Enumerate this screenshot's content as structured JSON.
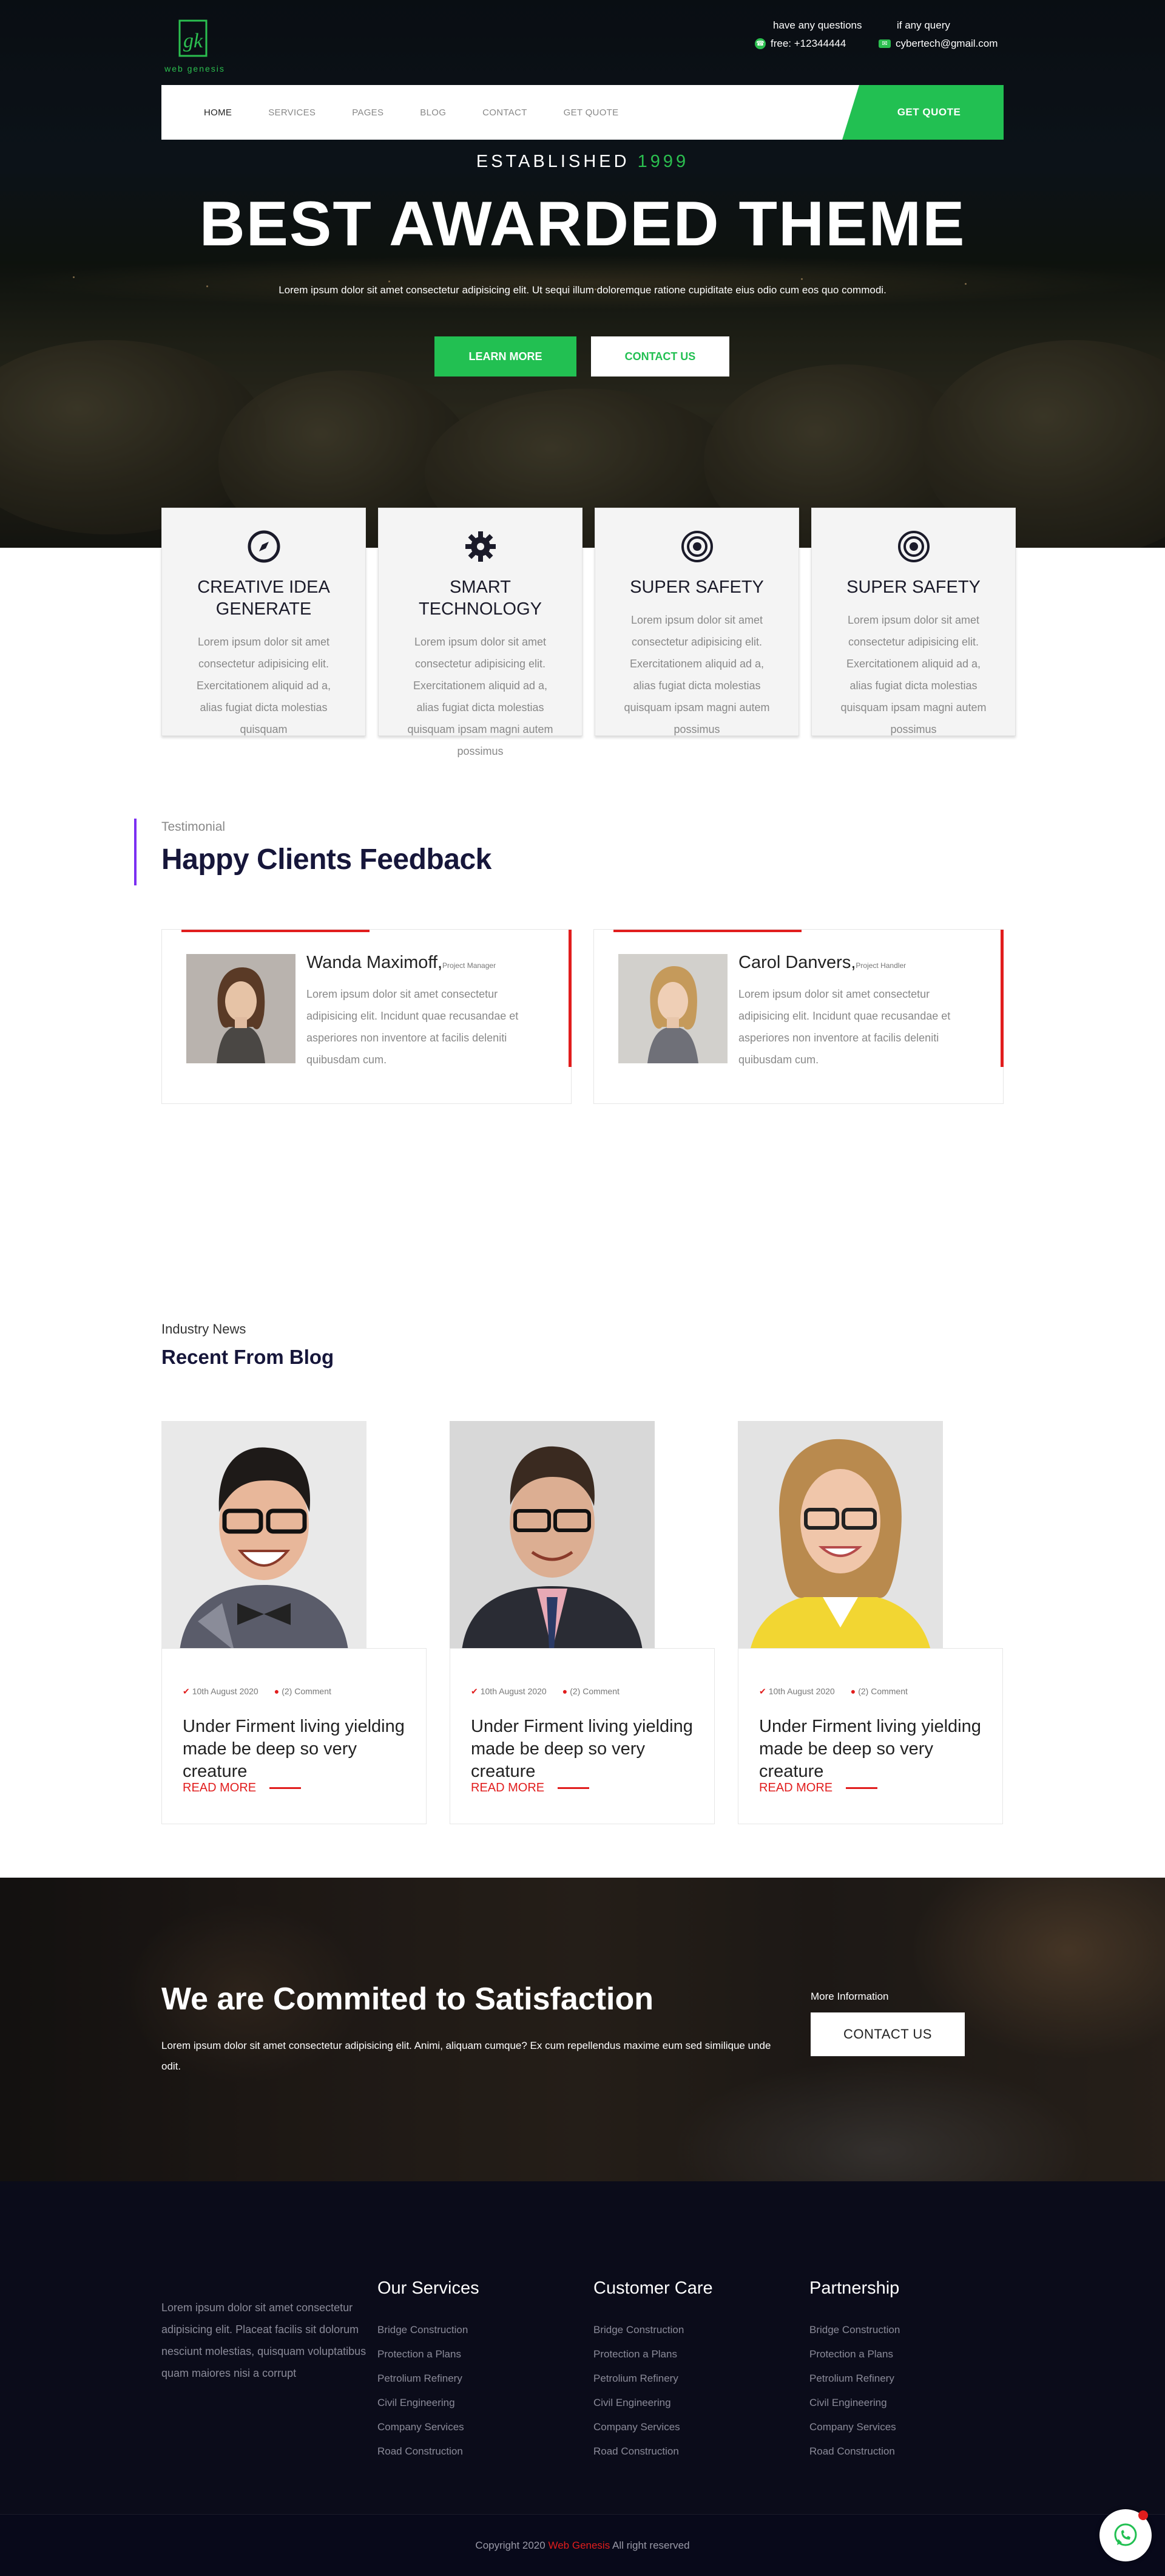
{
  "brand": {
    "logo_text": "web genesis",
    "logo_mark": "gk"
  },
  "header": {
    "phone_heading": "have any questions",
    "phone_value": "free: +12344444",
    "email_heading": "if any query",
    "email_value": "cybertech@gmail.com"
  },
  "nav": {
    "items": [
      "HOME",
      "SERVICES",
      "PAGES",
      "BLOG",
      "CONTACT",
      "GET QUOTE"
    ],
    "cta": "GET QUOTE"
  },
  "hero": {
    "established_label": "ESTABLISHED",
    "established_year": "1999",
    "title": "BEST AWARDED THEME",
    "subtitle": "Lorem ipsum dolor sit amet consectetur adipisicing elit. Ut sequi illum doloremque ratione cupiditate eius odio cum eos quo commodi.",
    "btn_learn": "LEARN MORE",
    "btn_contact": "CONTACT US"
  },
  "features": [
    {
      "icon": "compass-icon",
      "title": "CREATIVE IDEA GENERATE",
      "text": "Lorem ipsum dolor sit amet consectetur adipisicing elit. Exercitationem aliquid ad a, alias fugiat dicta molestias quisquam"
    },
    {
      "icon": "gear-icon",
      "title": "SMART TECHNOLOGY",
      "text": "Lorem ipsum dolor sit amet consectetur adipisicing elit. Exercitationem aliquid ad a, alias fugiat dicta molestias quisquam ipsam magni autem possimus"
    },
    {
      "icon": "target-icon",
      "title": "SUPER SAFETY",
      "text": "Lorem ipsum dolor sit amet consectetur adipisicing elit. Exercitationem aliquid ad a, alias fugiat dicta molestias quisquam ipsam magni autem possimus"
    },
    {
      "icon": "target-icon",
      "title": "SUPER SAFETY",
      "text": "Lorem ipsum dolor sit amet consectetur adipisicing elit. Exercitationem aliquid ad a, alias fugiat dicta molestias quisquam ipsam magni autem possimus"
    }
  ],
  "testimonials": {
    "kicker": "Testimonial",
    "title": "Happy Clients Feedback",
    "items": [
      {
        "name": "Wanda Maximoff,",
        "role": "Project Manager",
        "text": "Lorem ipsum dolor sit amet consectetur adipisicing elit. Incidunt quae recusandae et asperiores non inventore at facilis deleniti quibusdam cum."
      },
      {
        "name": "Carol Danvers,",
        "role": "Project Handler",
        "text": "Lorem ipsum dolor sit amet consectetur adipisicing elit. Incidunt quae recusandae et asperiores non inventore at facilis deleniti quibusdam cum."
      }
    ]
  },
  "blog": {
    "kicker": "Industry News",
    "title": "Recent From Blog",
    "posts": [
      {
        "date": "10th August 2020",
        "comments": "(2) Comment",
        "title": "Under Firment living yielding made be deep so very creature",
        "more": "READ MORE"
      },
      {
        "date": "10th August 2020",
        "comments": "(2) Comment",
        "title": "Under Firment living yielding made be deep so very creature",
        "more": "READ MORE"
      },
      {
        "date": "10th August 2020",
        "comments": "(2) Comment",
        "title": "Under Firment living yielding made be deep so very creature",
        "more": "READ MORE"
      }
    ]
  },
  "cta": {
    "title": "We are Commited to Satisfaction",
    "text": "Lorem ipsum dolor sit amet consectetur adipisicing elit. Animi, aliquam cumque? Ex cum repellendus maxime eum sed similique unde odit.",
    "more_label": "More Information",
    "button": "CONTACT US"
  },
  "footer": {
    "about": "Lorem ipsum dolor sit amet consectetur adipisicing elit. Placeat facilis sit dolorum nesciunt molestias, quisquam voluptatibus quam maiores nisi a corrupt",
    "columns": [
      {
        "title": "Our Services",
        "links": [
          "Bridge Construction",
          "Protection a Plans",
          "Petrolium Refinery",
          "Civil Engineering",
          "Company Services",
          "Road Construction"
        ]
      },
      {
        "title": "Customer Care",
        "links": [
          "Bridge Construction",
          "Protection a Plans",
          "Petrolium Refinery",
          "Civil Engineering",
          "Company Services",
          "Road Construction"
        ]
      },
      {
        "title": "Partnership",
        "links": [
          "Bridge Construction",
          "Protection a Plans",
          "Petrolium Refinery",
          "Civil Engineering",
          "Company Services",
          "Road Construction"
        ]
      }
    ],
    "copyright_prefix": "Copyright 2020",
    "copyright_brand": "Web Genesis",
    "copyright_suffix": "All right reserved"
  },
  "colors": {
    "accent_green": "#22c052",
    "accent_red": "#e11d1d",
    "accent_purple": "#7b2ff2",
    "footer_bg": "#0b0c1a"
  }
}
